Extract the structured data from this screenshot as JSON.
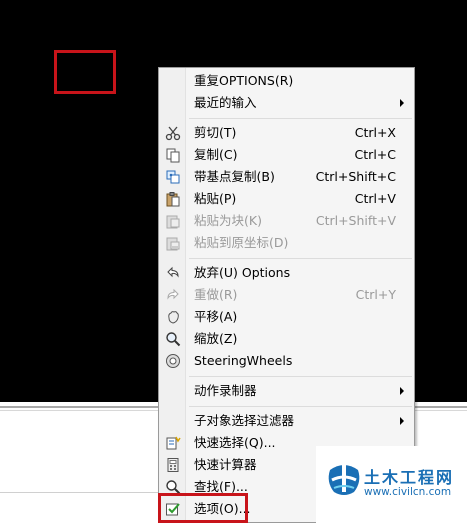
{
  "menu": {
    "items": [
      {
        "label": "重复OPTIONS(R)",
        "shortcut": "",
        "submenu": false,
        "disabled": false,
        "icon": ""
      },
      {
        "label": "最近的输入",
        "shortcut": "",
        "submenu": true,
        "disabled": false,
        "icon": ""
      },
      {
        "label": "剪切(T)",
        "shortcut": "Ctrl+X",
        "submenu": false,
        "disabled": false,
        "icon": "scissors-icon"
      },
      {
        "label": "复制(C)",
        "shortcut": "Ctrl+C",
        "submenu": false,
        "disabled": false,
        "icon": "copy-icon"
      },
      {
        "label": "带基点复制(B)",
        "shortcut": "Ctrl+Shift+C",
        "submenu": false,
        "disabled": false,
        "icon": "copy-basepoint-icon"
      },
      {
        "label": "粘贴(P)",
        "shortcut": "Ctrl+V",
        "submenu": false,
        "disabled": false,
        "icon": "paste-icon"
      },
      {
        "label": "粘贴为块(K)",
        "shortcut": "Ctrl+Shift+V",
        "submenu": false,
        "disabled": true,
        "icon": "paste-block-icon"
      },
      {
        "label": "粘贴到原坐标(D)",
        "shortcut": "",
        "submenu": false,
        "disabled": true,
        "icon": "paste-orig-coords-icon"
      },
      {
        "label": "放弃(U) Options",
        "shortcut": "",
        "submenu": false,
        "disabled": false,
        "icon": "undo-icon"
      },
      {
        "label": "重做(R)",
        "shortcut": "Ctrl+Y",
        "submenu": false,
        "disabled": true,
        "icon": "redo-icon"
      },
      {
        "label": "平移(A)",
        "shortcut": "",
        "submenu": false,
        "disabled": false,
        "icon": "pan-icon"
      },
      {
        "label": "缩放(Z)",
        "shortcut": "",
        "submenu": false,
        "disabled": false,
        "icon": "zoom-icon"
      },
      {
        "label": "SteeringWheels",
        "shortcut": "",
        "submenu": false,
        "disabled": false,
        "icon": "steering-wheel-icon"
      },
      {
        "label": "动作录制器",
        "shortcut": "",
        "submenu": true,
        "disabled": false,
        "icon": ""
      },
      {
        "label": "子对象选择过滤器",
        "shortcut": "",
        "submenu": true,
        "disabled": false,
        "icon": ""
      },
      {
        "label": "快速选择(Q)...",
        "shortcut": "",
        "submenu": false,
        "disabled": false,
        "icon": "quick-select-icon"
      },
      {
        "label": "快速计算器",
        "shortcut": "",
        "submenu": false,
        "disabled": false,
        "icon": "calculator-icon"
      },
      {
        "label": "查找(F)...",
        "shortcut": "",
        "submenu": false,
        "disabled": false,
        "icon": "find-icon"
      },
      {
        "label": "选项(O)...",
        "shortcut": "",
        "submenu": false,
        "disabled": false,
        "icon": "options-check-icon"
      }
    ]
  },
  "watermark": {
    "title": "土木工程网",
    "url": "www.civilcn.com"
  },
  "colors": {
    "highlight_red": "#c8141a",
    "watermark_blue": "#1a6fb5"
  }
}
